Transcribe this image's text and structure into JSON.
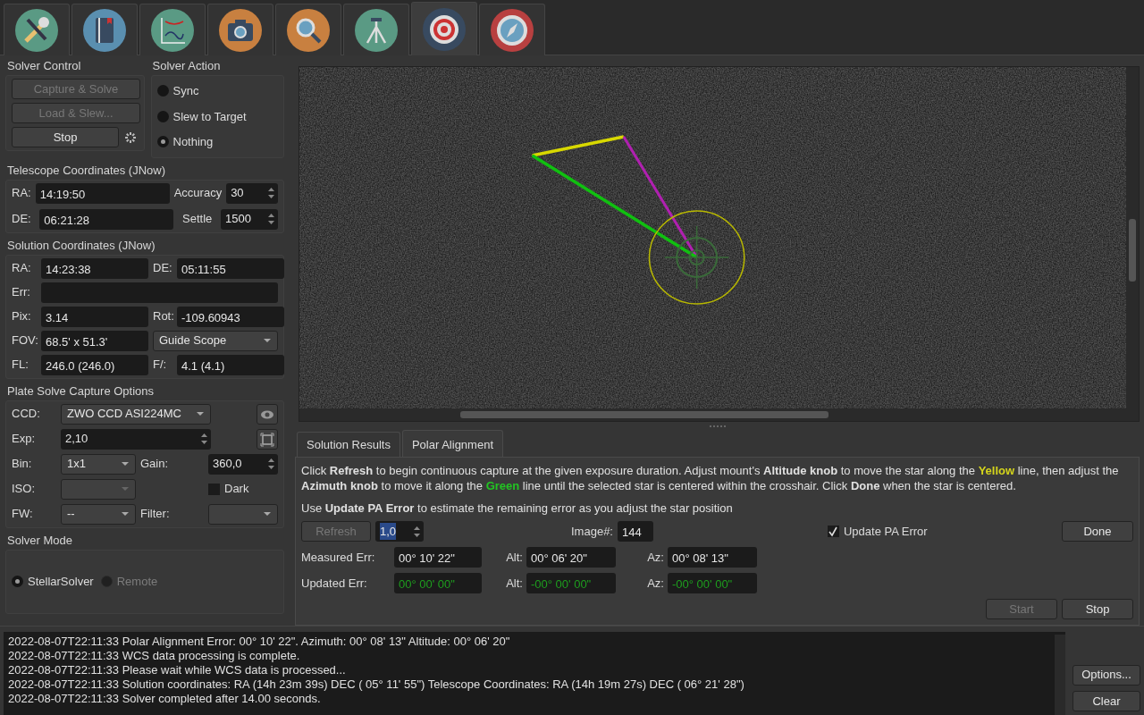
{
  "module_tabs": [
    {
      "kind": "tools",
      "selected": false
    },
    {
      "kind": "notebook",
      "selected": false
    },
    {
      "kind": "chart",
      "selected": false
    },
    {
      "kind": "camera",
      "selected": false
    },
    {
      "kind": "search",
      "selected": false
    },
    {
      "kind": "tripod",
      "selected": false
    },
    {
      "kind": "target",
      "selected": true
    },
    {
      "kind": "compass",
      "selected": false
    }
  ],
  "solver_control": {
    "title": "Solver Control",
    "buttons": [
      {
        "label": "Capture & Solve",
        "disabled": true
      },
      {
        "label": "Load & Slew...",
        "disabled": true
      },
      {
        "label": "Stop",
        "disabled": false
      }
    ]
  },
  "solver_action": {
    "title": "Solver Action",
    "options": [
      {
        "label": "Sync",
        "selected": false
      },
      {
        "label": "Slew to Target",
        "selected": false
      },
      {
        "label": "Nothing",
        "selected": true
      }
    ]
  },
  "telescope_coordinates": {
    "title": "Telescope Coordinates (JNow)",
    "rows": [
      {
        "label": "RA:",
        "value": "14:19:50",
        "spin_label": "Accuracy",
        "spin_value": "30"
      },
      {
        "label": "DE:",
        "value": "06:21:28",
        "spin_label": "Settle",
        "spin_value": "1500"
      }
    ]
  },
  "solution_coordinates": {
    "title": "Solution Coordinates (JNow)",
    "rows": [
      [
        {
          "kind": "field",
          "label": "RA:",
          "value": "14:23:38"
        },
        {
          "kind": "field",
          "label": "DE:",
          "value": "05:11:55"
        }
      ],
      [
        {
          "kind": "field",
          "label": "Err:"
        }
      ],
      [
        {
          "kind": "field",
          "label": "Pix:",
          "value": "3.14"
        },
        {
          "kind": "field",
          "label": "Rot:",
          "value": "-109.60943"
        }
      ],
      [
        {
          "kind": "field",
          "label": "FOV:",
          "value": "68.5' x 51.3'"
        },
        {
          "kind": "dropdown",
          "value": "Guide Scope"
        }
      ],
      [
        {
          "kind": "field",
          "label": "FL:",
          "value": "246.0 (246.0)"
        },
        {
          "kind": "field",
          "label": "F/:",
          "value": "4.1 (4.1)"
        }
      ]
    ]
  },
  "capture_options": {
    "title": "Plate Solve Capture Options",
    "ccd": {
      "label": "CCD:",
      "value": "ZWO CCD ASI224MC"
    },
    "exposure": {
      "label": "Exp:",
      "value": "2,10"
    },
    "binning": {
      "label": "Bin:",
      "value": "1x1"
    },
    "gain": {
      "label": "Gain:",
      "value": "360,0"
    },
    "iso": {
      "label": "ISO:",
      "disabled": true
    },
    "dark": {
      "label": "Dark",
      "checked": false
    },
    "filter_wheel": {
      "label": "FW:",
      "value": "--"
    },
    "filter": {
      "label": "Filter:"
    }
  },
  "solver_mode": {
    "title": "Solver Mode",
    "options": [
      {
        "label": "StellarSolver",
        "selected": true,
        "disabled": false
      },
      {
        "label": "Remote",
        "selected": false,
        "disabled": true
      }
    ]
  },
  "results_tabs": [
    {
      "label": "Solution Results",
      "selected": false
    },
    {
      "label": "Polar Alignment",
      "selected": true
    }
  ],
  "polar_alignment": {
    "instructions": [
      [
        {
          "text": "Click "
        },
        {
          "text": "Refresh",
          "bold": true
        },
        {
          "text": " to begin continuous capture at the given exposure duration. Adjust mount's "
        },
        {
          "text": "Altitude knob",
          "bold": true
        },
        {
          "text": " to move the star along the "
        },
        {
          "text": "Yellow",
          "bold": true,
          "color": "#d4d41c"
        },
        {
          "text": " line, then adjust the "
        },
        {
          "text": "Azimuth knob",
          "bold": true
        },
        {
          "text": " to move it along the "
        },
        {
          "text": "Green",
          "bold": true,
          "color": "#22c422"
        },
        {
          "text": " line until the selected star is centered within the crosshair. Click "
        },
        {
          "text": "Done",
          "bold": true
        },
        {
          "text": " when the star is centered."
        }
      ],
      [
        {
          "text": "Use "
        },
        {
          "text": "Update PA Error",
          "bold": true
        },
        {
          "text": " to estimate the remaining error as you adjust the star position"
        }
      ]
    ],
    "refresh": {
      "label": "Refresh",
      "disabled": true
    },
    "exposure": "1,0",
    "image_label": "Image#:",
    "image_value": "144",
    "update_error": {
      "label": "Update PA Error",
      "checked": true
    },
    "done": {
      "label": "Done",
      "disabled": false
    },
    "errors": [
      {
        "label": "Measured Err:",
        "total": "00° 10' 22\"",
        "alt_label": "Alt:",
        "alt": "00° 06' 20\"",
        "az_label": "Az:",
        "az": "00° 08' 13\"",
        "kind": "measured"
      },
      {
        "label": "Updated Err:",
        "total": "00° 00' 00\"",
        "alt_label": "Alt:",
        "alt": "-00° 00' 00\"",
        "az_label": "Az:",
        "az": "-00° 00' 00\"",
        "kind": "updated"
      }
    ],
    "start": {
      "label": "Start",
      "disabled": true
    },
    "stop": {
      "label": "Stop",
      "disabled": false
    }
  },
  "log": {
    "lines": [
      "2022-08-07T22:11:33 Polar Alignment Error:  00° 10' 22\". Azimuth:  00° 08' 13\"  Altitude:  00° 06' 20\"",
      "2022-08-07T22:11:33 WCS data processing is complete.",
      "2022-08-07T22:11:33 Please wait while WCS data is processed...",
      "2022-08-07T22:11:33 Solution coordinates: RA (14h 23m 39s) DEC ( 05° 11' 55\") Telescope Coordinates: RA (14h 19m 27s) DEC ( 06° 21' 28\")",
      "2022-08-07T22:11:33 Solver completed after 14.00 seconds."
    ],
    "buttons": [
      "Options...",
      "Clear"
    ]
  }
}
